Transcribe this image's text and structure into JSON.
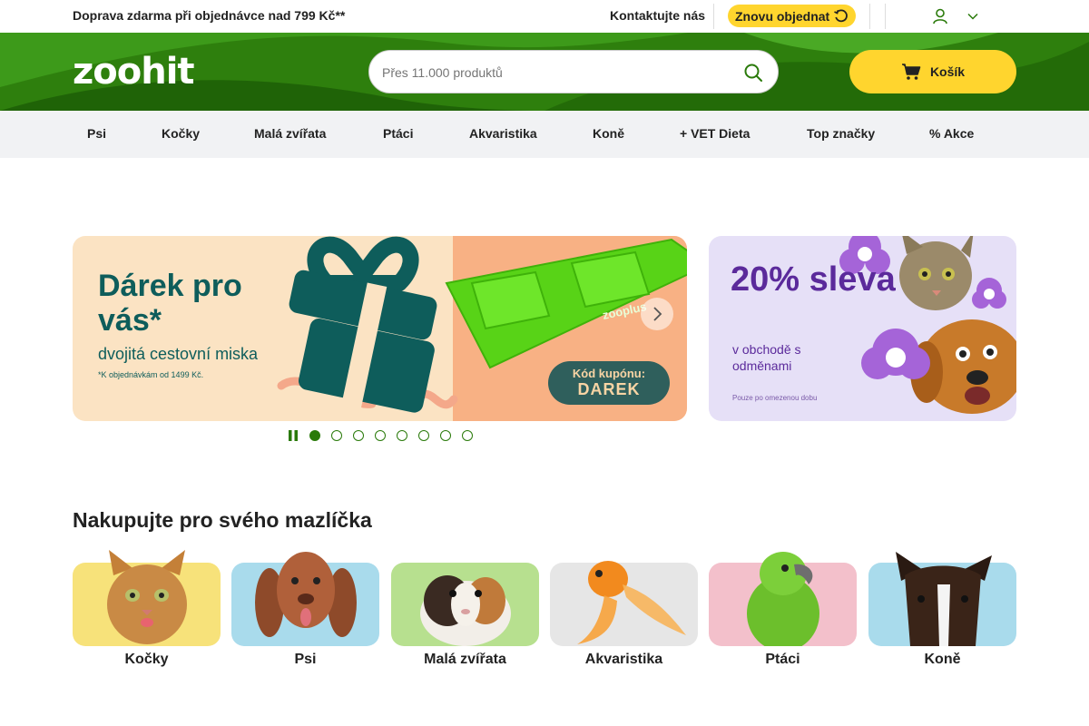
{
  "topbar": {
    "shipping": "Doprava zdarma při objednávce nad 799 Kč**",
    "contact": "Kontaktujte nás",
    "reorder": "Znovu objednat"
  },
  "header": {
    "logo": "zoohit",
    "search_placeholder": "Přes 11.000 produktů",
    "cart_label": "Košík"
  },
  "nav": {
    "items": [
      "Psi",
      "Kočky",
      "Malá zvířata",
      "Ptáci",
      "Akvaristika",
      "Koně",
      "+ VET Dieta",
      "Top značky",
      "% Akce"
    ]
  },
  "carousel": {
    "main": {
      "title": "Dárek pro vás*",
      "subtitle": "dvojitá cestovní miska",
      "note": "*K objednávkám od 1499 Kč.",
      "brand": "zooplus",
      "coupon_label": "Kód kupónu:",
      "coupon_code": "DAREK"
    },
    "side": {
      "title": "20% sleva",
      "subtitle": "v obchodě s odměnami",
      "note": "Pouze po omezenou dobu"
    },
    "active_index": 0,
    "slide_count": 8
  },
  "pets": {
    "title": "Nakupujte pro svého mazlíčka",
    "items": [
      {
        "label": "Kočky",
        "bg": "#f7e27a"
      },
      {
        "label": "Psi",
        "bg": "#a9dbec"
      },
      {
        "label": "Malá zvířata",
        "bg": "#b7e08f"
      },
      {
        "label": "Akvaristika",
        "bg": "#e6e6e6"
      },
      {
        "label": "Ptáci",
        "bg": "#f3c0cb"
      },
      {
        "label": "Koně",
        "bg": "#a9dbec"
      }
    ]
  },
  "colors": {
    "brand_green": "#2a7a0a",
    "accent_yellow": "#ffd52e",
    "nav_bg": "#f1f2f4"
  }
}
